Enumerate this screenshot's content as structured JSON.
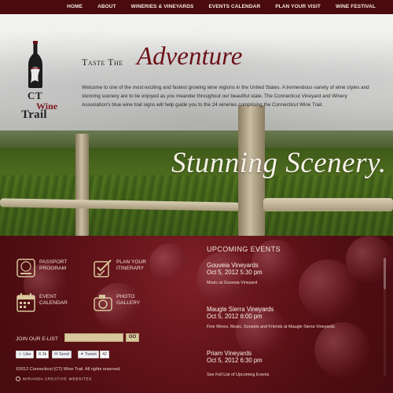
{
  "nav": {
    "items": [
      {
        "label": "HOME"
      },
      {
        "label": "ABOUT"
      },
      {
        "label": "WINERIES & VINEYARDS"
      },
      {
        "label": "EVENTS CALENDAR"
      },
      {
        "label": "PLAN YOUR VISIT"
      },
      {
        "label": "WINE FESTIVAL"
      }
    ]
  },
  "logo": {
    "line1": "CT",
    "line2": "Wine",
    "line3": "Trail"
  },
  "hero": {
    "tagline_small": "Taste The",
    "tagline_big": "Adventure",
    "intro": "Welcome to one of the most exciting and fastest growing wine regions in the United States. A tremendous variety of wine styles and stunning scenery are to be enjoyed as you meander throughout our beautiful state. The Connecticut Vineyard and Winery Association's blue wine trail signs will help guide you to the 24 wineries comprising the Connecticut Wine Trail.",
    "overlay": "Stunning Scenery."
  },
  "quicklinks": [
    {
      "line1": "PASSPORT",
      "line2": "PROGRAM",
      "icon": "passport-icon"
    },
    {
      "line1": "PLAN YOUR",
      "line2": "ITINERARY",
      "icon": "checklist-icon"
    },
    {
      "line1": "EVENT",
      "line2": "CALENDAR",
      "icon": "calendar-icon"
    },
    {
      "line1": "PHOTO",
      "line2": "GALLERY",
      "icon": "camera-icon"
    }
  ],
  "elist": {
    "label": "JOIN OUR E-LIST",
    "placeholder": "",
    "button": "GO"
  },
  "social": {
    "like_label": "Like",
    "like_count": "8.3k",
    "send_label": "Send",
    "tweet_label": "Tweet",
    "tweet_count": "42"
  },
  "footer": {
    "copyright": "©2012 Connecticut (CT) Wine Trail. All rights reserved.",
    "credit": "MIRANDA CREATIVE WEBSITES"
  },
  "events": {
    "title": "UPCOMING EVENTS",
    "items": [
      {
        "venue": "Gouveia Vineyards",
        "date": "Oct 5, 2012 5:30 pm",
        "desc": "Music at Gouveia Vineyard"
      },
      {
        "venue": "Maugle Sierra Vineyards",
        "date": "Oct 5, 2012 6:00 pm",
        "desc": "Fine Wines, Music, Sunsets and Friends at Maugle Sierra Vineyards"
      },
      {
        "venue": "Priam Vineyards",
        "date": "Oct 5, 2012 6:30 pm",
        "desc": ""
      }
    ],
    "full_list": "See Full List of Upcoming Events"
  },
  "colors": {
    "burgundy": "#5a0f12",
    "nav": "#4a0b0e",
    "cream": "#d8c79c",
    "title_red": "#6b1218"
  }
}
